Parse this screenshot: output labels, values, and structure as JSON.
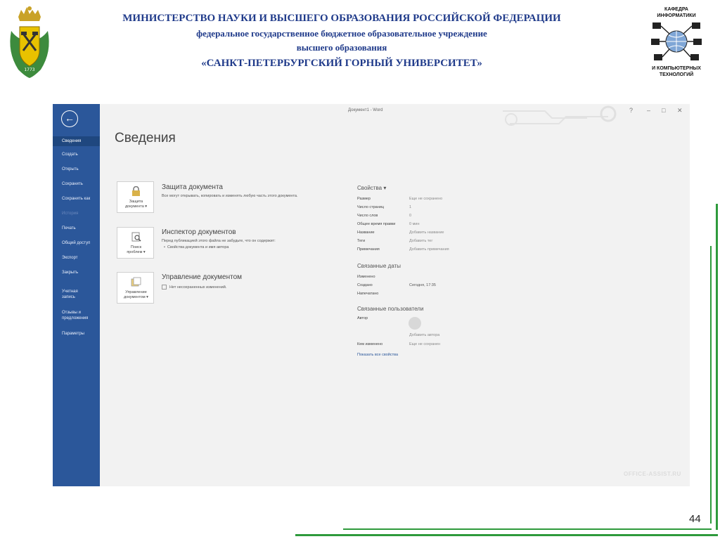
{
  "header": {
    "line1": "МИНИСТЕРСТВО НАУКИ И ВЫСШЕГО ОБРАЗОВАНИЯ РОССИЙСКОЙ ФЕДЕРАЦИИ",
    "line2": "федеральное государственное бюджетное образовательное учреждение",
    "line3": "высшего образования",
    "line4": "«САНКТ-ПЕТЕРБУРГСКИЙ ГОРНЫЙ УНИВЕРСИТЕТ»"
  },
  "crest": {
    "year": "1773"
  },
  "department": {
    "top": "КАФЕДРА",
    "top2": "ИНФОРМАТИКИ",
    "bottom": "И КОМПЬЮТЕРНЫХ",
    "bottom2": "ТЕХНОЛОГИЙ"
  },
  "colors": {
    "accent": "#2b579a",
    "frame": "#2e9a3c"
  },
  "word": {
    "window_title": "Документ1 - Word",
    "controls": [
      "?",
      "–",
      "□",
      "✕"
    ],
    "backstage": {
      "items": [
        {
          "label": "Сведения",
          "state": "selected"
        },
        {
          "label": "Создать",
          "state": "normal"
        },
        {
          "label": "Открыть",
          "state": "normal"
        },
        {
          "label": "Сохранить",
          "state": "normal"
        },
        {
          "label": "Сохранить как",
          "state": "normal"
        },
        {
          "label": "История",
          "state": "disabled"
        },
        {
          "label": "Печать",
          "state": "normal"
        },
        {
          "label": "Общий доступ",
          "state": "normal"
        },
        {
          "label": "Экспорт",
          "state": "normal"
        },
        {
          "label": "Закрыть",
          "state": "normal"
        },
        {
          "label": "Учетная",
          "label2": "запись",
          "state": "normal"
        },
        {
          "label": "Отзывы и",
          "label2": "предложения",
          "state": "normal"
        },
        {
          "label": "Параметры",
          "state": "normal"
        }
      ]
    },
    "page_title": "Сведения",
    "sections": [
      {
        "card_label": "Защита",
        "card_label2": "документа ▾",
        "icon": "lock-icon",
        "title": "Защита документа",
        "desc": "Все могут открывать, копировать и изменять любую часть этого документа."
      },
      {
        "card_label": "Поиск",
        "card_label2": "проблем ▾",
        "icon": "inspect-icon",
        "title": "Инспектор документов",
        "desc": "Перед публикацией этого файла не забудьте, что он содержит:",
        "bullet": "Свойства документа и имя автора"
      },
      {
        "card_label": "Управление",
        "card_label2": "документом ▾",
        "icon": "manage-icon",
        "title": "Управление документом",
        "desc": "Нет несохраненных изменений."
      }
    ],
    "properties": {
      "heading": "Свойства ▾",
      "rows": [
        {
          "k": "Размер",
          "v": "Еще не сохранено"
        },
        {
          "k": "Число страниц",
          "v": "1"
        },
        {
          "k": "Число слов",
          "v": "0"
        },
        {
          "k": "Общее время правки",
          "v": "0 мин"
        },
        {
          "k": "Название",
          "v": "Добавить название"
        },
        {
          "k": "Теги",
          "v": "Добавить тег"
        },
        {
          "k": "Примечания",
          "v": "Добавить примечания"
        }
      ],
      "dates_heading": "Связанные даты",
      "dates": [
        {
          "k": "Изменено",
          "v": ""
        },
        {
          "k": "Создано",
          "v": "Сегодня, 17:35"
        },
        {
          "k": "Напечатано",
          "v": ""
        }
      ],
      "people_heading": "Связанные пользователи",
      "author_key": "Автор",
      "add_author": "Добавить автора",
      "modified_by_key": "Кем изменено",
      "modified_by_value": "Еще не сохранен",
      "show_all": "Показать все свойства"
    },
    "watermark": "OFFICE-ASSIST.RU"
  },
  "slide_number": "44"
}
